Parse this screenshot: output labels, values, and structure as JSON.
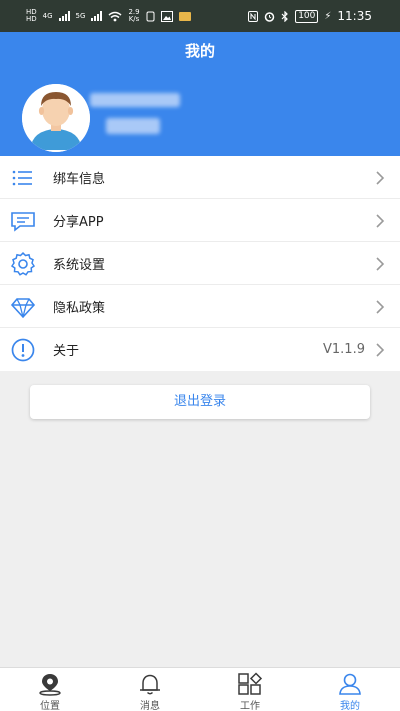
{
  "status_bar": {
    "net_left_top": "HD",
    "net_left_bottom": "HD",
    "signal1": "4G",
    "signal2": "5G",
    "speed_value": "2.9",
    "speed_unit": "K/s",
    "battery": "100",
    "time": "11:35"
  },
  "header": {
    "title": "我的"
  },
  "menu": [
    {
      "label": "绑车信息",
      "icon": "list-icon",
      "value": ""
    },
    {
      "label": "分享APP",
      "icon": "chat-share-icon",
      "value": ""
    },
    {
      "label": "系统设置",
      "icon": "gear-icon",
      "value": ""
    },
    {
      "label": "隐私政策",
      "icon": "diamond-icon",
      "value": ""
    },
    {
      "label": "关于",
      "icon": "info-icon",
      "value": "V1.1.9"
    }
  ],
  "logout_label": "退出登录",
  "tabs": [
    {
      "label": "位置",
      "icon": "location-pin-icon",
      "active": false
    },
    {
      "label": "消息",
      "icon": "bell-icon",
      "active": false
    },
    {
      "label": "工作",
      "icon": "grid-icon",
      "active": false
    },
    {
      "label": "我的",
      "icon": "user-icon",
      "active": true
    }
  ],
  "colors": {
    "accent": "#3a86ec",
    "status_bar": "#2f3a33",
    "background": "#efefef"
  }
}
